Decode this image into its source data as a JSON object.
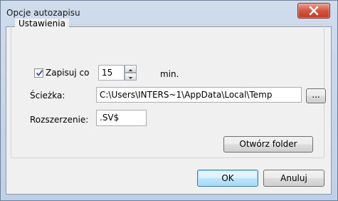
{
  "window": {
    "title": "Opcje autozapisu"
  },
  "group": {
    "legend": "Ustawienia"
  },
  "autosave": {
    "checkbox_label": "Zapisuj co",
    "checked": true,
    "interval_value": "15",
    "unit": "min."
  },
  "path": {
    "label": "Ścieżka:",
    "value": "C:\\Users\\INTERS~1\\AppData\\Local\\Temp",
    "browse_label": "..."
  },
  "extension": {
    "label": "Rozszerzenie:",
    "value": ".SV$"
  },
  "buttons": {
    "open_folder": "Otwórz folder",
    "ok": "OK",
    "cancel": "Anuluj"
  }
}
